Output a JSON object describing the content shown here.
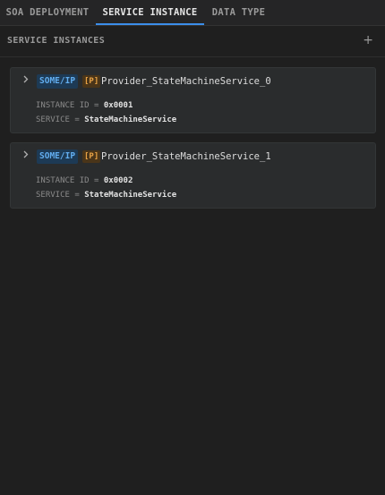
{
  "tabs": [
    {
      "label": "SOA DEPLOYMENT",
      "active": false
    },
    {
      "label": "SERVICE INSTANCE",
      "active": true
    },
    {
      "label": "DATA TYPE",
      "active": false
    }
  ],
  "section": {
    "title": "SERVICE INSTANCES",
    "add_icon": "+"
  },
  "instances": [
    {
      "protocol": "SOME/IP",
      "role_badge": "[P]",
      "name": "Provider_StateMachineService_0",
      "instance_id_label": "INSTANCE ID",
      "instance_id_value": "0x0001",
      "service_label": "SERVICE",
      "service_value": "StateMachineService"
    },
    {
      "protocol": "SOME/IP",
      "role_badge": "[P]",
      "name": "Provider_StateMachineService_1",
      "instance_id_label": "INSTANCE ID",
      "instance_id_value": "0x0002",
      "service_label": "SERVICE",
      "service_value": "StateMachineService"
    }
  ],
  "colors": {
    "background": "#1f1f1f",
    "accent": "#3b8eea",
    "protocol_badge": "#62aef0",
    "role_badge": "#e8a245"
  }
}
